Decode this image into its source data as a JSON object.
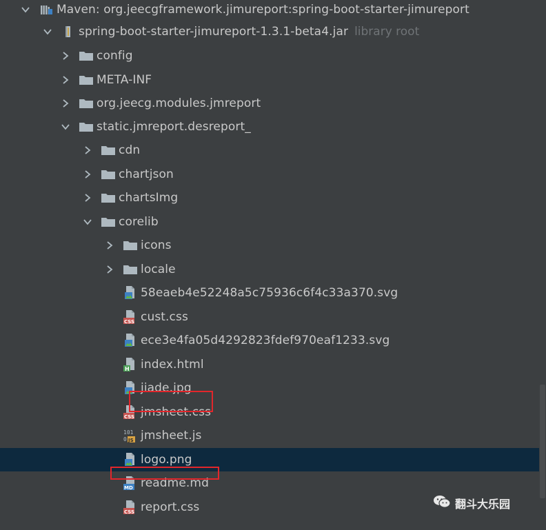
{
  "tree": {
    "rows": [
      {
        "id": "maven",
        "label": "Maven: org.jeecgframework.jimureport:spring-boot-starter-jimureport",
        "indent": 0,
        "expanded": true,
        "icon": "maven-library-icon"
      },
      {
        "id": "jar",
        "label": "spring-boot-starter-jimureport-1.3.1-beta4.jar",
        "hint": "library root",
        "indent": 1,
        "expanded": true,
        "icon": "jar-icon"
      },
      {
        "id": "config",
        "label": "config",
        "indent": 2,
        "expanded": false,
        "icon": "folder-icon"
      },
      {
        "id": "meta-inf",
        "label": "META-INF",
        "indent": 2,
        "expanded": false,
        "icon": "folder-icon"
      },
      {
        "id": "org-jeecg",
        "label": "org.jeecg.modules.jmreport",
        "indent": 2,
        "expanded": false,
        "icon": "folder-icon"
      },
      {
        "id": "static",
        "label": "static.jmreport.desreport_",
        "indent": 2,
        "expanded": true,
        "icon": "folder-icon"
      },
      {
        "id": "cdn",
        "label": "cdn",
        "indent": 3,
        "expanded": false,
        "icon": "folder-icon"
      },
      {
        "id": "chartjson",
        "label": "chartjson",
        "indent": 3,
        "expanded": false,
        "icon": "folder-icon"
      },
      {
        "id": "chartsimg",
        "label": "chartsImg",
        "indent": 3,
        "expanded": false,
        "icon": "folder-icon"
      },
      {
        "id": "corelib",
        "label": "corelib",
        "indent": 3,
        "expanded": true,
        "icon": "folder-icon"
      },
      {
        "id": "icons",
        "label": "icons",
        "indent": 4,
        "expanded": false,
        "icon": "folder-icon"
      },
      {
        "id": "locale",
        "label": "locale",
        "indent": 4,
        "expanded": false,
        "icon": "folder-icon"
      },
      {
        "id": "svg1",
        "label": "58eaeb4e52248a5c75936c6f4c33a370.svg",
        "indent": 4,
        "leaf": true,
        "icon": "image-file-icon"
      },
      {
        "id": "custcss",
        "label": "cust.css",
        "indent": 4,
        "leaf": true,
        "icon": "css-file-icon"
      },
      {
        "id": "svg2",
        "label": "ece3e4fa05d4292823fdef970eaf1233.svg",
        "indent": 4,
        "leaf": true,
        "icon": "image-file-icon"
      },
      {
        "id": "indexhtml",
        "label": "index.html",
        "indent": 4,
        "leaf": true,
        "icon": "html-file-icon"
      },
      {
        "id": "jiade",
        "label": "jiade.jpg",
        "indent": 4,
        "leaf": true,
        "icon": "image-file-icon",
        "highlight": true
      },
      {
        "id": "jmsheetcss",
        "label": "jmsheet.css",
        "indent": 4,
        "leaf": true,
        "icon": "css-file-icon"
      },
      {
        "id": "jmsheetjs",
        "label": "jmsheet.js",
        "indent": 4,
        "leaf": true,
        "icon": "js-file-icon"
      },
      {
        "id": "logo",
        "label": "logo.png",
        "indent": 4,
        "leaf": true,
        "icon": "image-file-icon",
        "highlight": true,
        "selected": true
      },
      {
        "id": "readme",
        "label": "readme.md",
        "indent": 4,
        "leaf": true,
        "icon": "md-file-icon"
      },
      {
        "id": "reportcss",
        "label": "report.css",
        "indent": 4,
        "leaf": true,
        "icon": "css-file-icon"
      }
    ]
  },
  "watermark": {
    "text": "翻斗大乐园",
    "icon": "wechat-icon"
  },
  "colors": {
    "background": "#3c3f41",
    "selected": "#0d293e",
    "highlight_border": "#e2262b",
    "folder": "#aeb9c0",
    "text": "#c9c9c9",
    "hint": "#6f7376"
  }
}
